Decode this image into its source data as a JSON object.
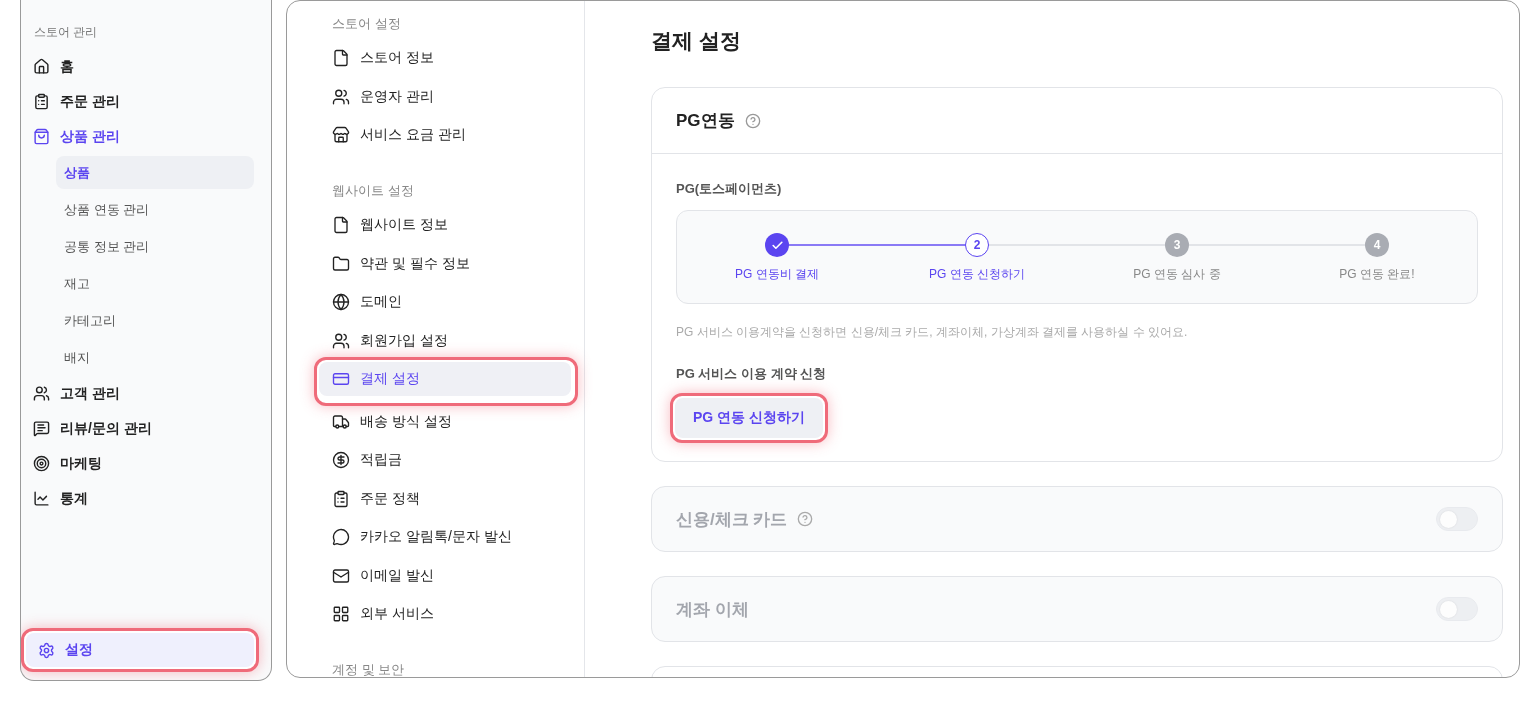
{
  "store_sidebar": {
    "section_label": "스토어 관리",
    "items": [
      {
        "label": "홈",
        "selected": false
      },
      {
        "label": "주문 관리",
        "selected": false
      },
      {
        "label": "상품 관리",
        "selected": true,
        "children": [
          {
            "label": "상품",
            "selected": true
          },
          {
            "label": "상품 연동 관리",
            "selected": false
          },
          {
            "label": "공통 정보 관리",
            "selected": false
          },
          {
            "label": "재고",
            "selected": false
          },
          {
            "label": "카테고리",
            "selected": false
          },
          {
            "label": "배지",
            "selected": false
          }
        ]
      },
      {
        "label": "고객 관리",
        "selected": false
      },
      {
        "label": "리뷰/문의 관리",
        "selected": false
      },
      {
        "label": "마케팅",
        "selected": false
      },
      {
        "label": "통계",
        "selected": false
      }
    ],
    "settings_item": {
      "label": "설정",
      "selected": true,
      "highlighted": true
    }
  },
  "settings_nav": [
    {
      "heading": "스토어 설정",
      "items": [
        {
          "label": "스토어 정보",
          "selected": false,
          "highlighted": false
        },
        {
          "label": "운영자 관리",
          "selected": false,
          "highlighted": false
        },
        {
          "label": "서비스 요금 관리",
          "selected": false,
          "highlighted": false
        }
      ]
    },
    {
      "heading": "웹사이트 설정",
      "items": [
        {
          "label": "웹사이트 정보",
          "selected": false,
          "highlighted": false
        },
        {
          "label": "약관 및 필수 정보",
          "selected": false,
          "highlighted": false
        },
        {
          "label": "도메인",
          "selected": false,
          "highlighted": false
        },
        {
          "label": "회원가입 설정",
          "selected": false,
          "highlighted": false
        },
        {
          "label": "결제 설정",
          "selected": true,
          "highlighted": true
        },
        {
          "label": "배송 방식 설정",
          "selected": false,
          "highlighted": false
        },
        {
          "label": "적립금",
          "selected": false,
          "highlighted": false
        },
        {
          "label": "주문 정책",
          "selected": false,
          "highlighted": false
        },
        {
          "label": "카카오 알림톡/문자 발신",
          "selected": false,
          "highlighted": false
        },
        {
          "label": "이메일 발신",
          "selected": false,
          "highlighted": false
        },
        {
          "label": "외부 서비스",
          "selected": false,
          "highlighted": false
        }
      ]
    },
    {
      "heading": "계정 및 보안"
    }
  ],
  "page_title": "결제 설정",
  "pg_card": {
    "title": "PG연동",
    "provider_label": "PG(토스페이먼츠)",
    "steps": [
      {
        "label": "PG 연동비 결제",
        "done": true,
        "current": false
      },
      {
        "number": "2",
        "label": "PG 연동 신청하기",
        "done": false,
        "current": true
      },
      {
        "number": "3",
        "label": "PG 연동 심사 중",
        "done": false,
        "current": false
      },
      {
        "number": "4",
        "label": "PG 연동 완료!",
        "done": false,
        "current": false
      }
    ],
    "description": "PG 서비스 이용계약을 신청하면 신용/체크 카드, 계좌이체, 가상계좌 결제를 사용하실 수 있어요.",
    "apply_label": "PG 서비스 이용 계약 신청",
    "apply_button": {
      "label": "PG 연동 신청하기",
      "highlighted": true
    }
  },
  "payment_methods": [
    {
      "label": "신용/체크 카드",
      "help": true,
      "on": false,
      "disabled": true
    },
    {
      "label": "계좌 이체",
      "help": false,
      "on": false,
      "disabled": true
    }
  ]
}
